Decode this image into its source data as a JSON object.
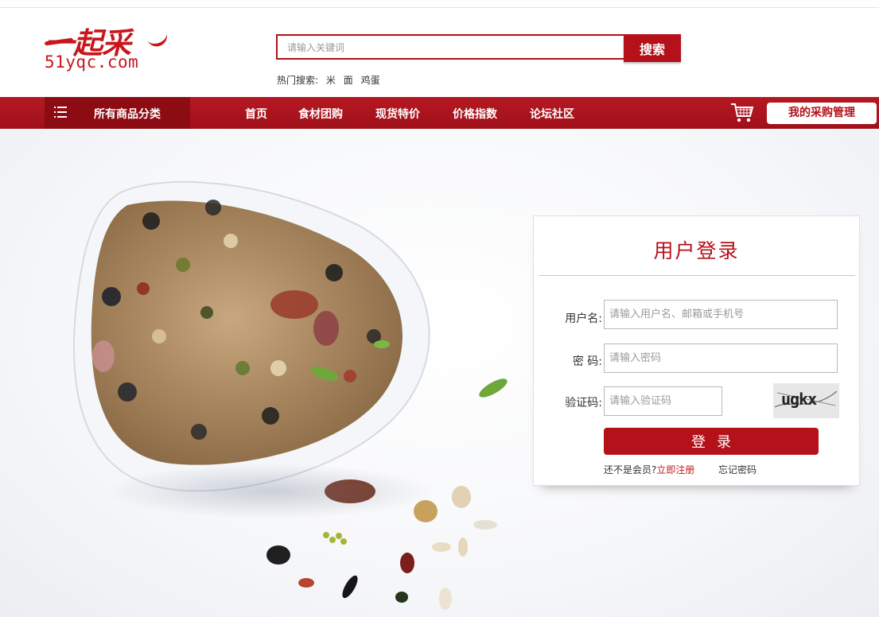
{
  "logo": {
    "cn": "一起采",
    "en": "51yqc.com"
  },
  "search": {
    "placeholder": "请输入关键词",
    "button_label": "搜索",
    "hot_label": "热门搜索:",
    "hot_terms": [
      "米",
      "面",
      "鸡蛋"
    ]
  },
  "nav": {
    "category_label": "所有商品分类",
    "links": [
      "首页",
      "食材团购",
      "现货特价",
      "价格指数",
      "论坛社区"
    ],
    "cart_icon": "cart-icon",
    "my_purchase_label": "我的采购管理"
  },
  "colors": {
    "brand_red": "#b4111a",
    "nav_dark": "#8d0b13"
  },
  "login": {
    "title": "用户登录",
    "username_label": "用户名:",
    "username_placeholder": "请输入用户名、邮箱或手机号",
    "password_label": "密 码:",
    "password_placeholder": "请输入密码",
    "captcha_label": "验证码:",
    "captcha_placeholder": "请输入验证码",
    "captcha_text": "ugkx",
    "submit_label": "登录",
    "not_member": "还不是会员?",
    "register_label": "立即注册",
    "forgot_label": "忘记密码"
  }
}
